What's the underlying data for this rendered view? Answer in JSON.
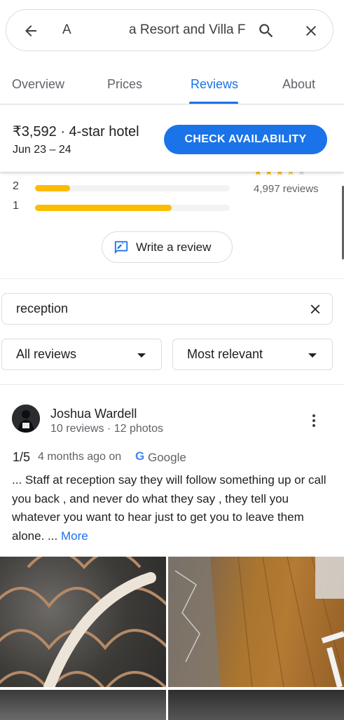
{
  "search": {
    "query_start": "A",
    "query_end": "a Resort and Villa F"
  },
  "tabs": [
    {
      "label": "Overview"
    },
    {
      "label": "Prices"
    },
    {
      "label": "Reviews"
    },
    {
      "label": "About"
    }
  ],
  "price_bar": {
    "price": "₹3,592 · 4-star hotel",
    "dates": "Jun 23 – 24",
    "button_label": "CHECK AVAILABILITY"
  },
  "ratings": {
    "rows": [
      {
        "star": "2",
        "fraction": 0.18
      },
      {
        "star": "1",
        "fraction": 0.7
      }
    ],
    "stars_display": 3.5,
    "review_count": "4,997 reviews",
    "write_review_label": "Write a review"
  },
  "filters": {
    "search_value": "reception",
    "sort_all": "All reviews",
    "sort_relevance": "Most relevant"
  },
  "review": {
    "author": "Joshua Wardell",
    "meta": "10 reviews · 12 photos",
    "score": "1/5",
    "time": "4 months ago on",
    "source": "Google",
    "source_glyph": "G",
    "text": "... Staff at reception say they will follow something up or call you back , and never do what they say , they tell you whatever you want to hear just to get you to leave them alone. ...",
    "more_label": "More"
  },
  "colors": {
    "accent": "#1a73e8",
    "star": "#fbbc04"
  }
}
